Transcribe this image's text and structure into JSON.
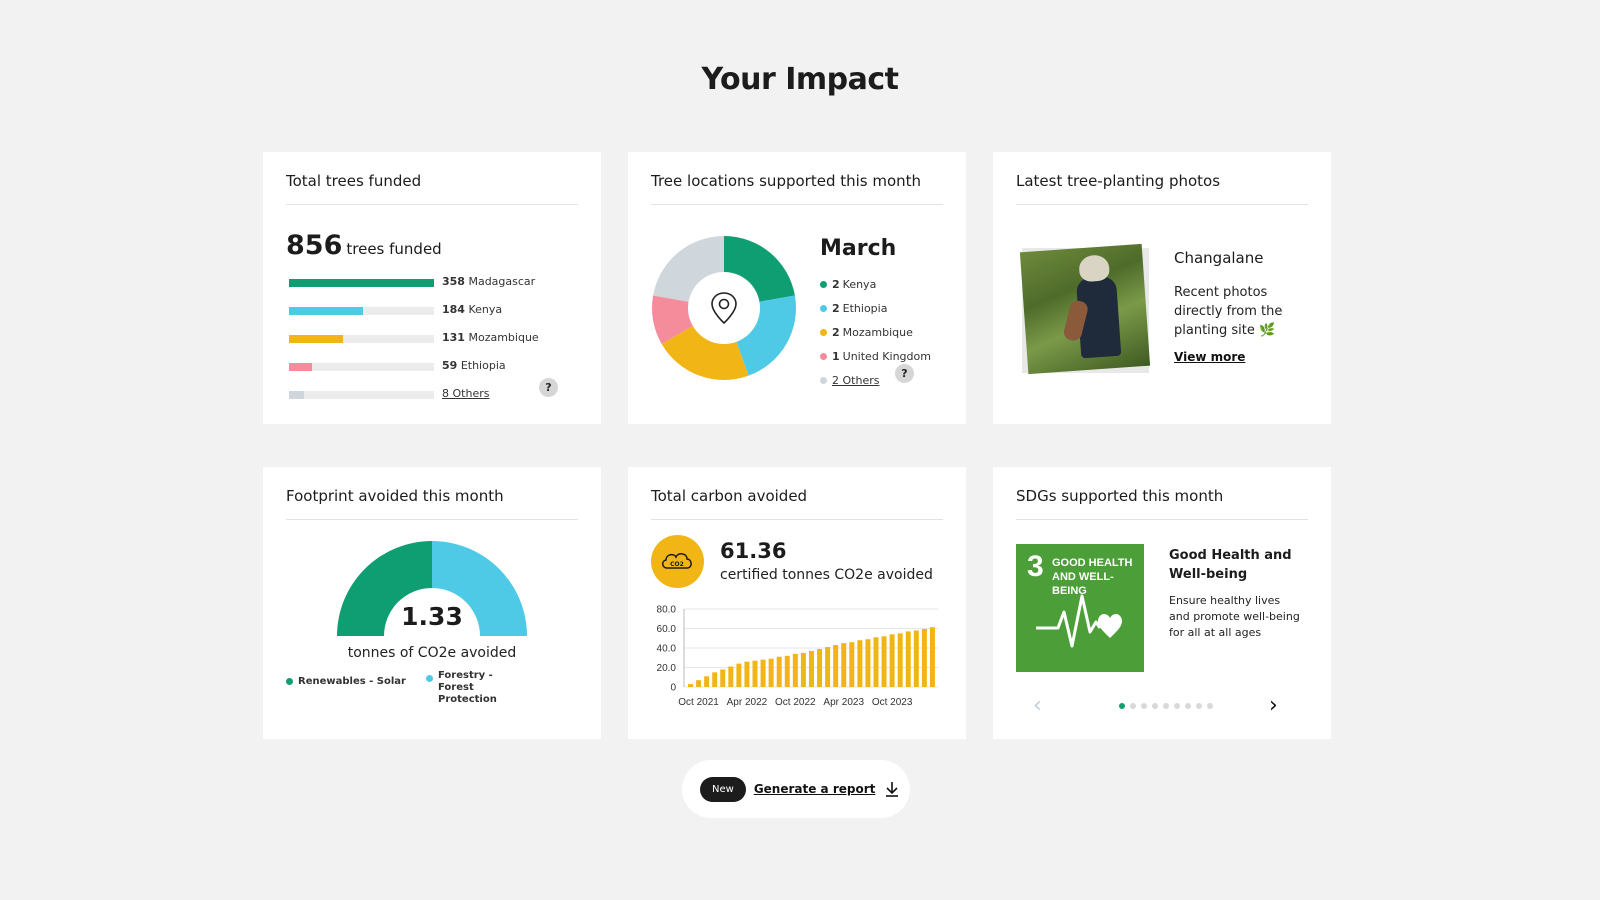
{
  "page": {
    "title": "Your Impact"
  },
  "trees": {
    "title": "Total trees funded",
    "total": "856",
    "total_unit": "trees funded",
    "rows": [
      {
        "count": "358",
        "name": "Madagascar",
        "fraction": 1.0,
        "color": "#0f9d72"
      },
      {
        "count": "184",
        "name": "Kenya",
        "fraction": 0.51,
        "color": "#4ec9e6"
      },
      {
        "count": "131",
        "name": "Mozambique",
        "fraction": 0.37,
        "color": "#f2b516"
      },
      {
        "count": "59",
        "name": "Ethiopia",
        "fraction": 0.16,
        "color": "#f58c9b"
      }
    ],
    "others": {
      "label": "8 Others",
      "fraction": 0.1,
      "color": "#cfd6dc"
    },
    "help": "?"
  },
  "locations": {
    "title": "Tree locations supported this month",
    "month": "March",
    "items": [
      {
        "count": "2",
        "name": "Kenya",
        "value": 2,
        "color": "#0f9d72"
      },
      {
        "count": "2",
        "name": "Ethiopia",
        "value": 2,
        "color": "#4ec9e6"
      },
      {
        "count": "2",
        "name": "Mozambique",
        "value": 2,
        "color": "#f2b516"
      },
      {
        "count": "1",
        "name": "United Kingdom",
        "value": 1,
        "color": "#f58c9b"
      }
    ],
    "others": {
      "label": "2 Others",
      "value": 2,
      "color": "#cfd6dc"
    },
    "help": "?",
    "center_icon": "map-pin-icon"
  },
  "photos": {
    "title": "Latest tree-planting photos",
    "site": "Changalane",
    "description": "Recent photos directly from the planting site 🌿",
    "link": "View more"
  },
  "footprint": {
    "title": "Footprint avoided this month",
    "value": "1.33",
    "caption": "tonnes of CO2e avoided",
    "segments": [
      {
        "name": "Renewables - Solar",
        "share": 0.5,
        "color": "#0f9d72"
      },
      {
        "name": "Forestry - Forest Protection",
        "share": 0.5,
        "color": "#4ec9e6"
      }
    ]
  },
  "carbon": {
    "title": "Total carbon avoided",
    "badge": "CO2",
    "value": "61.36",
    "caption": "certified tonnes CO2e avoided",
    "bar_color": "#f2b516"
  },
  "chart_data": {
    "type": "bar",
    "title": "",
    "xlabel": "",
    "ylabel": "",
    "ylim": [
      0,
      80
    ],
    "yticks": [
      "80.0",
      "60.0",
      "40.0",
      "20.0",
      "0"
    ],
    "xticks": [
      "Oct 2021",
      "Apr 2022",
      "Oct 2022",
      "Apr 2023",
      "Oct 2023"
    ],
    "categories": [
      "2021-09",
      "2021-10",
      "2021-11",
      "2021-12",
      "2022-01",
      "2022-02",
      "2022-03",
      "2022-04",
      "2022-05",
      "2022-06",
      "2022-07",
      "2022-08",
      "2022-09",
      "2022-10",
      "2022-11",
      "2022-12",
      "2023-01",
      "2023-02",
      "2023-03",
      "2023-04",
      "2023-05",
      "2023-06",
      "2023-07",
      "2023-08",
      "2023-09",
      "2023-10",
      "2023-11",
      "2023-12",
      "2024-01",
      "2024-02",
      "2024-03"
    ],
    "values": [
      3,
      7,
      11,
      15,
      18,
      21,
      24,
      26,
      27,
      28,
      29,
      31,
      32,
      34,
      35,
      37,
      39,
      41,
      43,
      45,
      46,
      48,
      49,
      51,
      52,
      54,
      55,
      57,
      58,
      59.5,
      61.36
    ],
    "grid": true
  },
  "sdg": {
    "title": "SDGs supported this month",
    "number": "3",
    "tile_name": "GOOD HEALTH AND WELL-BEING",
    "goal": "Good Health and Well-being",
    "description": "Ensure healthy lives and promote well-being for all at all ages",
    "tile_color": "#4c9f38",
    "prev": "‹",
    "next": "›",
    "dots": 9,
    "active_dot": 0
  },
  "report": {
    "badge": "New",
    "link": "Generate a report",
    "icon": "download-icon"
  }
}
